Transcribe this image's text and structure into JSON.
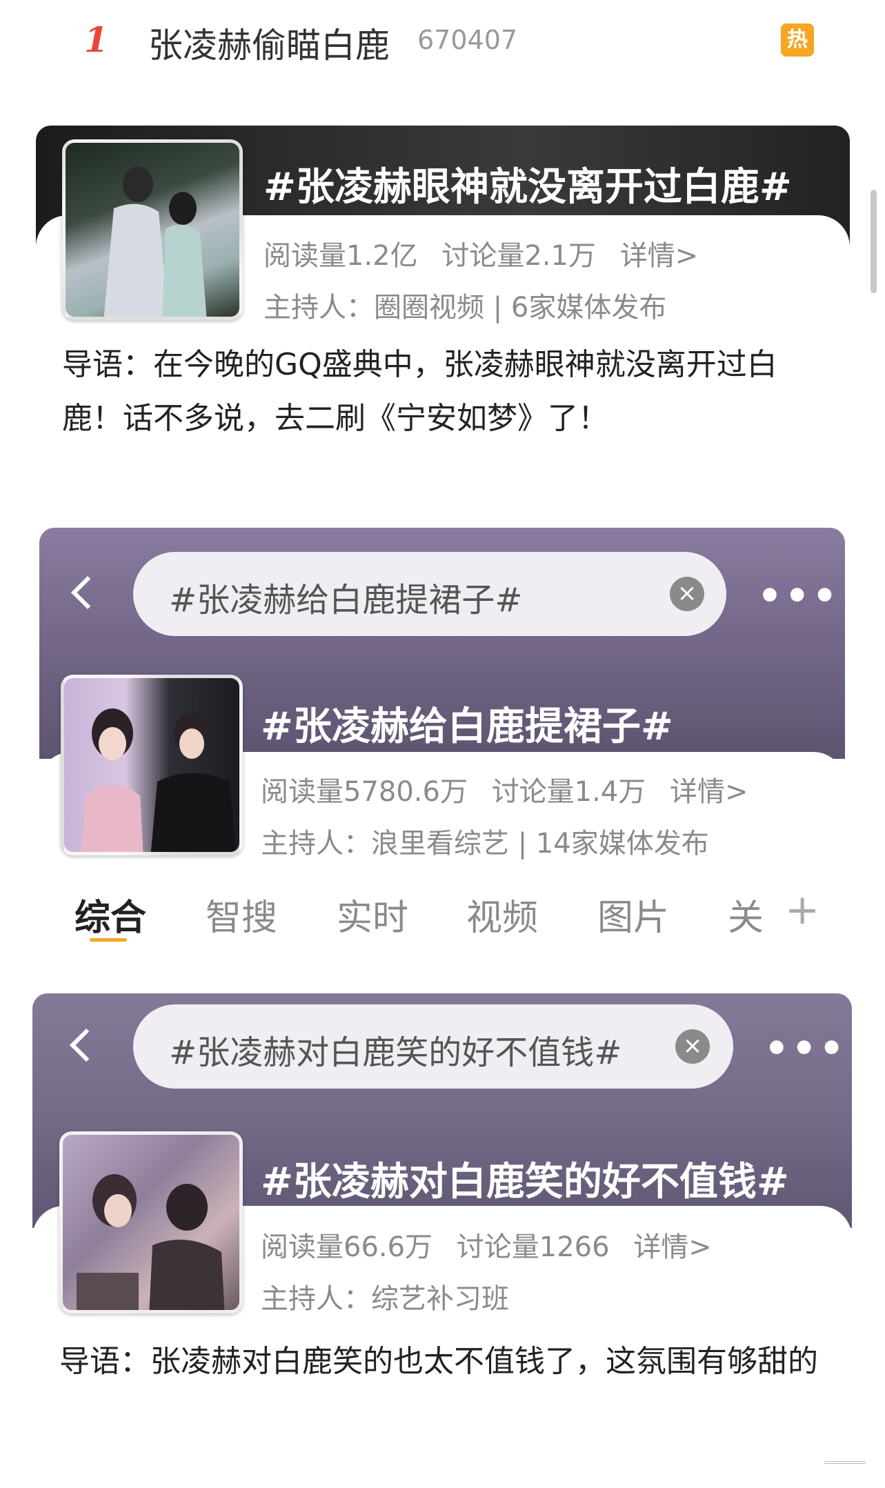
{
  "hot_item": {
    "rank": "1",
    "title": "张凌赫偷瞄白鹿",
    "count": "670407",
    "badge": "热"
  },
  "card1": {
    "topic": "#张凌赫眼神就没离开过白鹿#",
    "reads": "阅读量1.2亿",
    "discussions": "讨论量2.1万",
    "details": "详情>",
    "host": "主持人：圈圈视频 | 6家媒体发布",
    "intro": "导语：在今晚的GQ盛典中，张凌赫眼神就没离开过白鹿！话不多说，去二刷《宁安如梦》了！"
  },
  "card2": {
    "search_text": "#张凌赫给白鹿提裙子#",
    "clear_icon": "×",
    "more_icon": "•••",
    "topic": "#张凌赫给白鹿提裙子#",
    "reads": "阅读量5780.6万",
    "discussions": "讨论量1.4万",
    "details": "详情>",
    "host": "主持人：浪里看综艺 | 14家媒体发布"
  },
  "tabs": {
    "items": [
      "综合",
      "智搜",
      "实时",
      "视频",
      "图片",
      "关"
    ],
    "active": "综合",
    "plus": "+",
    "accent": "#f5a623"
  },
  "card3": {
    "search_text": "#张凌赫对白鹿笑的好不值钱#",
    "clear_icon": "×",
    "more_icon": "•••",
    "topic": "#张凌赫对白鹿笑的好不值钱#",
    "reads": "阅读量66.6万",
    "discussions": "讨论量1266",
    "details": "详情>",
    "host": "主持人：综艺补习班",
    "intro": "导语：张凌赫对白鹿笑的也太不值钱了，这氛围有够甜的"
  },
  "colors": {
    "rank_red": "#e8453c",
    "hot_badge": "#f5a623",
    "card1_bg": "#2b2b2b",
    "card2_bg": "#7d6f92",
    "card3_bg": "#7a7090"
  }
}
